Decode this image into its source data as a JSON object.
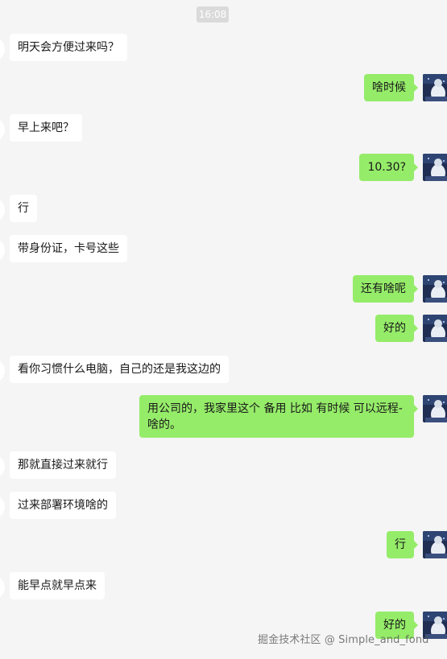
{
  "chat": {
    "timestamp": "16:08",
    "messages": [
      {
        "side": "in",
        "text": "明天会方便过来吗？"
      },
      {
        "side": "out",
        "text": "啥时候"
      },
      {
        "side": "in",
        "text": "早上来吧？"
      },
      {
        "side": "out",
        "text": "10.30?"
      },
      {
        "side": "in",
        "text": "行"
      },
      {
        "side": "in",
        "text": "带身份证，卡号这些"
      },
      {
        "side": "out",
        "text": "还有啥呢"
      },
      {
        "side": "out",
        "text": "好的"
      },
      {
        "side": "in",
        "text": "看你习惯什么电脑，自己的还是我这边的"
      },
      {
        "side": "out",
        "text": "用公司的，我家里这个 备用  比如 有时候 可以远程-啥的。"
      },
      {
        "side": "in",
        "text": "那就直接过来就行"
      },
      {
        "side": "in",
        "text": "过来部署环境啥的"
      },
      {
        "side": "out",
        "text": "行"
      },
      {
        "side": "in",
        "text": "能早点就早点来"
      },
      {
        "side": "out",
        "text": "好的"
      }
    ]
  },
  "watermark": "掘金技术社区 @ Simple_and_fond",
  "colors": {
    "background": "#f5f5f5",
    "incoming_bubble": "#ffffff",
    "outgoing_bubble": "#95ec69"
  }
}
